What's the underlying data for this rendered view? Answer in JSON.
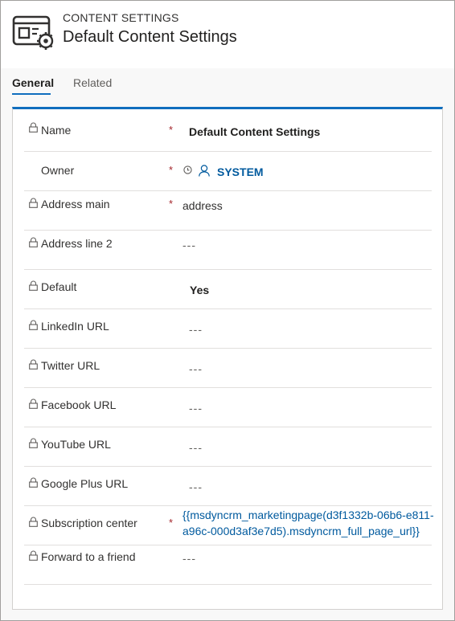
{
  "header": {
    "entity_type": "CONTENT SETTINGS",
    "record_title": "Default Content Settings",
    "icon": "content-settings-icon"
  },
  "tabs": [
    {
      "label": "General",
      "active": true
    },
    {
      "label": "Related",
      "active": false
    }
  ],
  "colors": {
    "accent": "#106ebe",
    "required": "#a4262c",
    "link": "#005a9e"
  },
  "fields": {
    "name": {
      "label": "Name",
      "required": true,
      "value": "Default Content Settings",
      "locked": true
    },
    "owner": {
      "label": "Owner",
      "required": true,
      "value": "SYSTEM",
      "locked": false
    },
    "address_main": {
      "label": "Address main",
      "required": true,
      "value": "address",
      "locked": true
    },
    "address_line2": {
      "label": "Address line 2",
      "required": false,
      "value": "---",
      "locked": true
    },
    "default": {
      "label": "Default",
      "required": false,
      "value": "Yes",
      "locked": true
    },
    "linkedin": {
      "label": "LinkedIn URL",
      "required": false,
      "value": "---",
      "locked": true
    },
    "twitter": {
      "label": "Twitter URL",
      "required": false,
      "value": "---",
      "locked": true
    },
    "facebook": {
      "label": "Facebook URL",
      "required": false,
      "value": "---",
      "locked": true
    },
    "youtube": {
      "label": "YouTube URL",
      "required": false,
      "value": "---",
      "locked": true
    },
    "googleplus": {
      "label": "Google Plus URL",
      "required": false,
      "value": "---",
      "locked": true
    },
    "subscription": {
      "label": "Subscription center",
      "required": true,
      "value": "{{msdyncrm_marketingpage(d3f1332b-06b6-e811-a96c-000d3af3e7d5).msdyncrm_full_page_url}}",
      "locked": true
    },
    "forward": {
      "label": "Forward to a friend",
      "required": false,
      "value": "---",
      "locked": true
    }
  },
  "required_marker": "*"
}
